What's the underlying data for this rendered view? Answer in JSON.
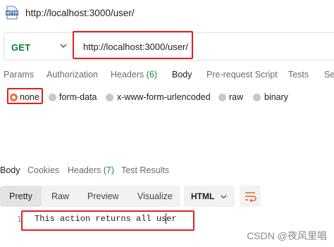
{
  "request": {
    "title": "http://localhost:3000/user/",
    "method": "GET",
    "url": "http://localhost:3000/user/"
  },
  "request_tabs": [
    {
      "label": "Params"
    },
    {
      "label": "Authorization"
    },
    {
      "label": "Headers",
      "count": "(6)"
    },
    {
      "label": "Body",
      "active": true
    },
    {
      "label": "Pre-request Script"
    },
    {
      "label": "Tests"
    },
    {
      "label": "Se"
    }
  ],
  "body_types": [
    {
      "label": "none",
      "selected": true
    },
    {
      "label": "form-data"
    },
    {
      "label": "x-www-form-urlencoded"
    },
    {
      "label": "raw"
    },
    {
      "label": "binary"
    }
  ],
  "response_tabs": [
    {
      "label": "Body",
      "active": true
    },
    {
      "label": "Cookies"
    },
    {
      "label": "Headers",
      "count": "(7)"
    },
    {
      "label": "Test Results"
    }
  ],
  "view_modes": [
    {
      "label": "Pretty",
      "active": true
    },
    {
      "label": "Raw"
    },
    {
      "label": "Preview"
    },
    {
      "label": "Visualize"
    }
  ],
  "response_format": "HTML",
  "code": {
    "line_number": "1",
    "text": "This action returns all user"
  },
  "watermark": "CSDN @夜风里唱",
  "colors": {
    "get_method": "#0e7d3b",
    "highlight_box": "#e02020",
    "radio_selected": "#f26b3a",
    "count_green": "#0e8f3a"
  },
  "icons": {
    "request_type": "http-file-icon",
    "method_dropdown": "chevron-down-icon",
    "format_dropdown": "chevron-down-icon",
    "wrap_lines": "wrap-lines-icon"
  }
}
